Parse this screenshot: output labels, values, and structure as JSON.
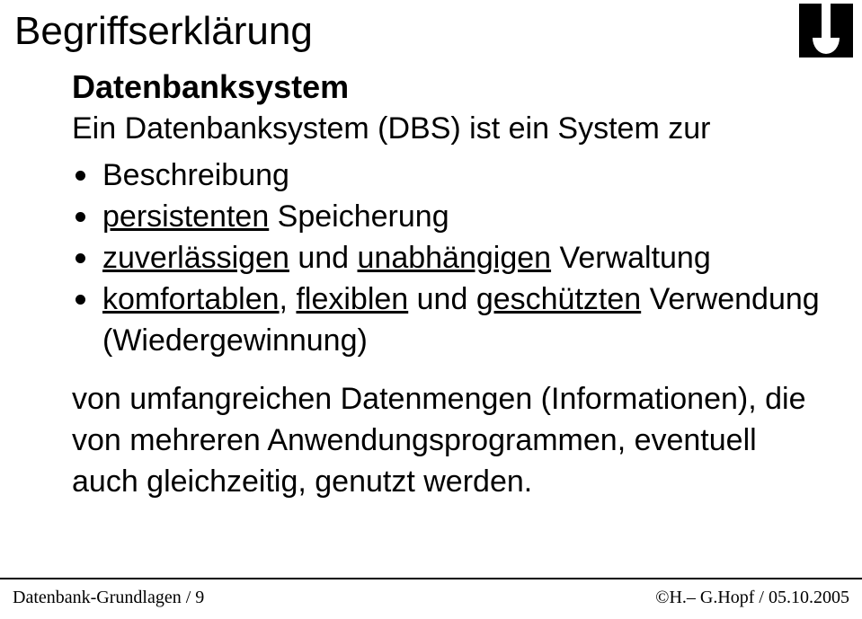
{
  "title": "Begriffserklärung",
  "subtitle": "Datenbanksystem",
  "intro": "Ein Datenbanksystem (DBS) ist ein System zur",
  "bullets": [
    {
      "plain": "Beschreibung"
    },
    {
      "u1": "persistenten",
      "rest": " Speicherung"
    },
    {
      "u1": "zuverlässigen",
      "mid": " und ",
      "u2": "unabhängigen",
      "rest": " Verwaltung"
    },
    {
      "u1": "komfortablen",
      "mid": ", ",
      "u2": "flexiblen",
      "mid2": " und ",
      "u3": "geschützten",
      "rest": " Verwendung (Wiedergewinnung)"
    }
  ],
  "paragraph": "von umfangreichen Datenmengen (Informationen), die von mehreren Anwendungsprogrammen, eventuell auch gleichzeitig, genutzt werden.",
  "footer": {
    "left": "Datenbank-Grundlagen / 9",
    "right": "©H.– G.Hopf / 05.10.2005"
  },
  "logo": {
    "name": "ohm-logo"
  }
}
